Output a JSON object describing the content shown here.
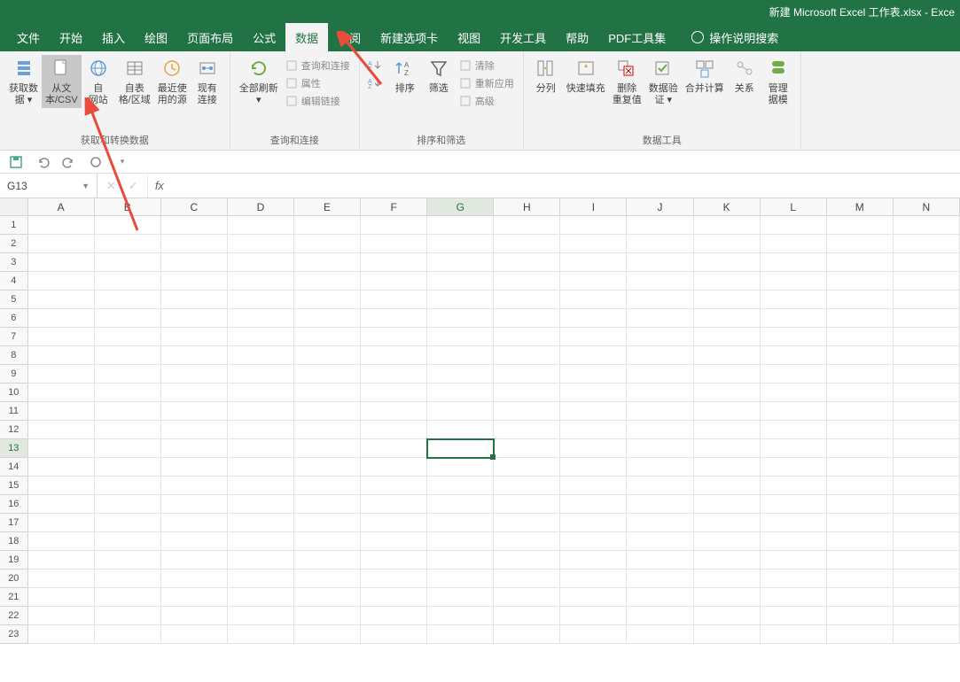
{
  "titlebar": {
    "title": "新建 Microsoft Excel 工作表.xlsx - Exce"
  },
  "tabs": {
    "items": [
      "文件",
      "开始",
      "插入",
      "绘图",
      "页面布局",
      "公式",
      "数据",
      "审阅",
      "新建选项卡",
      "视图",
      "开发工具",
      "帮助",
      "PDF工具集"
    ],
    "active_index": 6,
    "search_hint": "操作说明搜索"
  },
  "ribbon": {
    "groups": [
      {
        "label": "获取和转换数据",
        "buttons": [
          {
            "name": "get-data",
            "label": "获取数\n据 ▾"
          },
          {
            "name": "from-text-csv",
            "label": "从文\n本/CSV",
            "highlight": true
          },
          {
            "name": "from-web",
            "label": "自\n网站"
          },
          {
            "name": "from-table-range",
            "label": "自表\n格/区域"
          },
          {
            "name": "recent-sources",
            "label": "最近使\n用的源"
          },
          {
            "name": "existing-connections",
            "label": "现有\n连接"
          }
        ]
      },
      {
        "label": "查询和连接",
        "buttons": [
          {
            "name": "refresh-all",
            "label": "全部刷新\n▾"
          }
        ],
        "mini": [
          {
            "name": "queries-connections",
            "label": "查询和连接"
          },
          {
            "name": "properties",
            "label": "属性"
          },
          {
            "name": "edit-links",
            "label": "编辑链接"
          }
        ]
      },
      {
        "label": "排序和筛选",
        "tiny": [
          {
            "name": "sort-asc-icon"
          },
          {
            "name": "sort-desc-icon"
          }
        ],
        "buttons": [
          {
            "name": "sort",
            "label": "排序"
          },
          {
            "name": "filter",
            "label": "筛选"
          }
        ],
        "mini": [
          {
            "name": "clear",
            "label": "清除"
          },
          {
            "name": "reapply",
            "label": "重新应用"
          },
          {
            "name": "advanced",
            "label": "高级"
          }
        ]
      },
      {
        "label": "数据工具",
        "buttons": [
          {
            "name": "text-to-columns",
            "label": "分列"
          },
          {
            "name": "flash-fill",
            "label": "快速填充"
          },
          {
            "name": "remove-duplicates",
            "label": "删除\n重复值"
          },
          {
            "name": "data-validation",
            "label": "数据验\n证 ▾"
          },
          {
            "name": "consolidate",
            "label": "合并计算"
          },
          {
            "name": "relationships",
            "label": "关系"
          },
          {
            "name": "manage-model",
            "label": "管理\n据模"
          }
        ]
      }
    ]
  },
  "qat": {
    "items": [
      "save-icon",
      "undo-icon",
      "redo-icon",
      "touch-mode-icon",
      "customize-icon"
    ]
  },
  "formula_bar": {
    "name_box": "G13",
    "fx_label": "fx"
  },
  "grid": {
    "columns": [
      "A",
      "B",
      "C",
      "D",
      "E",
      "F",
      "G",
      "H",
      "I",
      "J",
      "K",
      "L",
      "M",
      "N"
    ],
    "rows": 23,
    "selected": {
      "col_index": 6,
      "row": 13
    }
  }
}
